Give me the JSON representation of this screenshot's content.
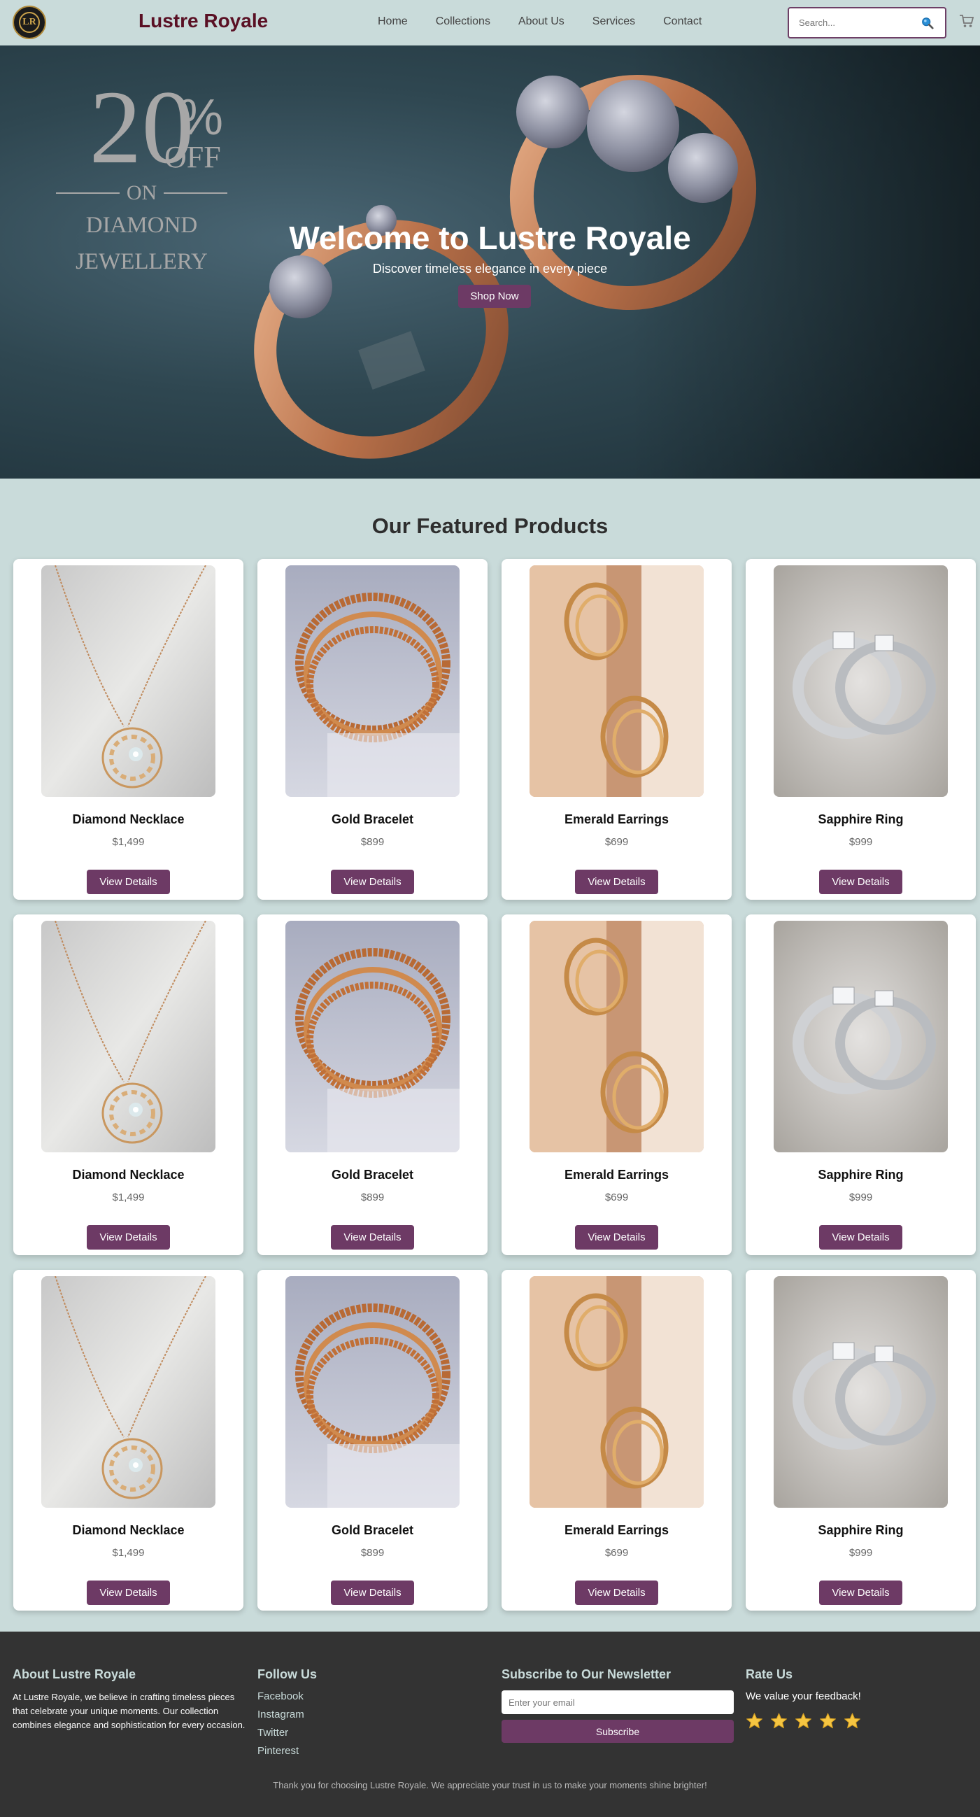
{
  "header": {
    "logo_text": "LR",
    "brand": "Lustre Royale",
    "nav": [
      "Home",
      "Collections",
      "About Us",
      "Services",
      "Contact"
    ],
    "search_placeholder": "Search...",
    "search_icon": "search-icon",
    "cart_icon": "cart-icon"
  },
  "hero": {
    "promo": {
      "number": "20",
      "percent": "%",
      "off": "OFF",
      "on": "ON",
      "line1": "DIAMOND",
      "line2": "JEWELLERY"
    },
    "title": "Welcome to Lustre Royale",
    "subtitle": "Discover timeless elegance in every piece",
    "cta": "Shop Now"
  },
  "featured": {
    "title": "Our Featured Products",
    "button_label": "View Details",
    "products": [
      {
        "name": "Diamond Necklace",
        "price": "$1,499",
        "image": "necklace"
      },
      {
        "name": "Gold Bracelet",
        "price": "$899",
        "image": "bracelet"
      },
      {
        "name": "Emerald Earrings",
        "price": "$699",
        "image": "earrings"
      },
      {
        "name": "Sapphire Ring",
        "price": "$999",
        "image": "ring"
      },
      {
        "name": "Diamond Necklace",
        "price": "$1,499",
        "image": "necklace"
      },
      {
        "name": "Gold Bracelet",
        "price": "$899",
        "image": "bracelet"
      },
      {
        "name": "Emerald Earrings",
        "price": "$699",
        "image": "earrings"
      },
      {
        "name": "Sapphire Ring",
        "price": "$999",
        "image": "ring"
      },
      {
        "name": "Diamond Necklace",
        "price": "$1,499",
        "image": "necklace"
      },
      {
        "name": "Gold Bracelet",
        "price": "$899",
        "image": "bracelet"
      },
      {
        "name": "Emerald Earrings",
        "price": "$699",
        "image": "earrings"
      },
      {
        "name": "Sapphire Ring",
        "price": "$999",
        "image": "ring"
      }
    ]
  },
  "footer": {
    "about_title": "About Lustre Royale",
    "about_text": "At Lustre Royale, we believe in crafting timeless pieces that celebrate your unique moments. Our collection combines elegance and sophistication for every occasion.",
    "follow_title": "Follow Us",
    "social": [
      "Facebook",
      "Instagram",
      "Twitter",
      "Pinterest"
    ],
    "newsletter_title": "Subscribe to Our Newsletter",
    "email_placeholder": "Enter your email",
    "subscribe_label": "Subscribe",
    "rate_title": "Rate Us",
    "rate_text": "We value your feedback!",
    "rating": 5,
    "star_color": "#f5c542",
    "note": "Thank you for choosing Lustre Royale. We appreciate your trust in us to make your moments shine brighter!"
  },
  "colors": {
    "brand": "#5a1024",
    "accent": "#6d3a65",
    "page_bg": "#c9dbda",
    "footer_bg": "#333333"
  }
}
